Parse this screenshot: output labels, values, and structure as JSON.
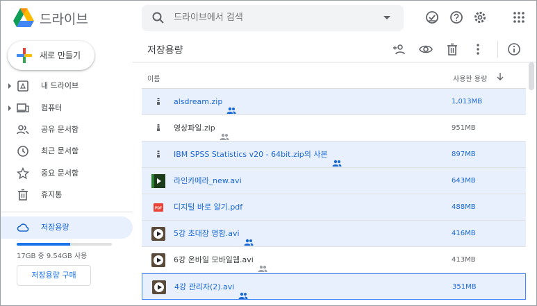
{
  "app": {
    "name": "드라이브"
  },
  "search": {
    "placeholder": "드라이브에서 검색"
  },
  "sidebar": {
    "new_label": "새로 만들기",
    "items": [
      {
        "label": "내 드라이브"
      },
      {
        "label": "컴퓨터"
      },
      {
        "label": "공유 문서함"
      },
      {
        "label": "최근 문서함"
      },
      {
        "label": "중요 문서함"
      },
      {
        "label": "휴지통"
      }
    ],
    "storage_label": "저장용량",
    "storage_usage": "17GB 중 9.54GB 사용",
    "storage_fraction": 0.56,
    "buy_label": "저장용량 구매"
  },
  "main": {
    "title": "저장용량",
    "col_name": "이름",
    "col_size": "사용한 용량",
    "files": [
      {
        "name": "alsdream.zip",
        "size": "1,013MB",
        "type": "zip",
        "shared": true,
        "state": "sel"
      },
      {
        "name": "영상파일.zip",
        "size": "951MB",
        "type": "zip",
        "shared": true,
        "state": ""
      },
      {
        "name": "IBM SPSS Statistics v20 - 64bit.zip의 사본",
        "size": "897MB",
        "type": "zip",
        "shared": true,
        "state": "sel"
      },
      {
        "name": "라인카메라_new.avi",
        "size": "643MB",
        "type": "video-dark",
        "shared": false,
        "state": "sel"
      },
      {
        "name": "디지털 바로 알기.pdf",
        "size": "488MB",
        "type": "pdf",
        "shared": false,
        "state": "sel"
      },
      {
        "name": "5강 초대장 명함.avi",
        "size": "416MB",
        "type": "video",
        "shared": true,
        "state": "sel"
      },
      {
        "name": "6강 온바일 모바일웹.avi",
        "size": "413MB",
        "type": "video",
        "shared": true,
        "state": ""
      },
      {
        "name": "4강 관리자(2).avi",
        "size": "351MB",
        "type": "video",
        "shared": true,
        "state": "focus"
      }
    ]
  },
  "colors": {
    "accent": "#1a73e8",
    "selected_bg": "#e8f0fe",
    "selected_text": "#1967d2"
  }
}
